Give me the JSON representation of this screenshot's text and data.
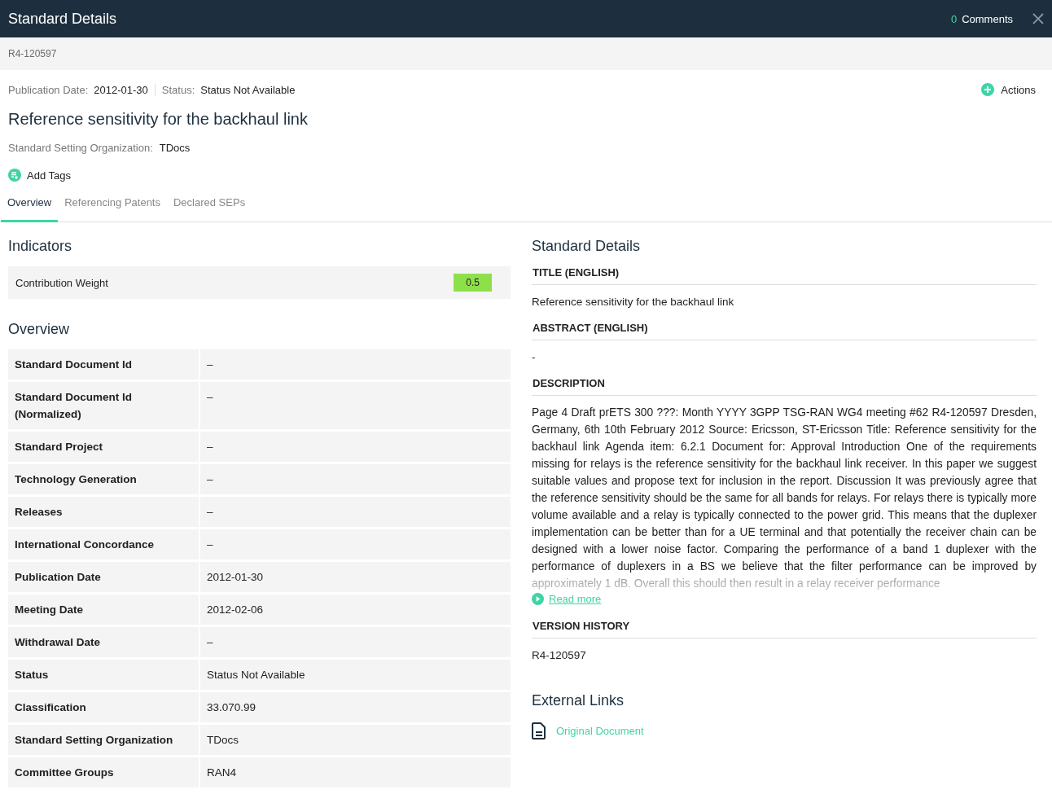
{
  "header": {
    "title": "Standard Details",
    "comment_count": "0",
    "comments_label": "Comments"
  },
  "document_id": "R4-120597",
  "meta": [
    {
      "label": "Publication Date:",
      "value": "2012-01-30"
    },
    {
      "label": "Status:",
      "value": "Status Not Available"
    }
  ],
  "actions_label": "Actions",
  "title": "Reference sensitivity for the backhaul link",
  "organization": {
    "label": "Standard Setting Organization:",
    "value": "TDocs"
  },
  "add_tags_label": "Add Tags",
  "tabs": [
    {
      "label": "Overview",
      "selected": true
    },
    {
      "label": "Referencing Patents",
      "selected": false
    },
    {
      "label": "Declared SEPs",
      "selected": false
    }
  ],
  "indicators": {
    "heading": "Indicators",
    "items": [
      {
        "label": "Contribution Weight",
        "value": "0.5"
      }
    ]
  },
  "overview": {
    "heading": "Overview",
    "rows": [
      {
        "label": "Standard Document Id",
        "value": "–"
      },
      {
        "label": "Standard Document Id (Normalized)",
        "value": "–"
      },
      {
        "label": "Standard Project",
        "value": "–"
      },
      {
        "label": "Technology Generation",
        "value": "–"
      },
      {
        "label": "Releases",
        "value": "–"
      },
      {
        "label": "International Concordance",
        "value": "–"
      },
      {
        "label": "Publication Date",
        "value": "2012-01-30"
      },
      {
        "label": "Meeting Date",
        "value": "2012-02-06"
      },
      {
        "label": "Withdrawal Date",
        "value": "–"
      },
      {
        "label": "Status",
        "value": "Status Not Available"
      },
      {
        "label": "Classification",
        "value": "33.070.99"
      },
      {
        "label": "Standard Setting Organization",
        "value": "TDocs"
      },
      {
        "label": "Committee Groups",
        "value": "RAN4"
      }
    ]
  },
  "details": {
    "heading": "Standard Details",
    "sections": [
      {
        "heading": "TITLE (ENGLISH)",
        "text": "Reference sensitivity for the backhaul link"
      },
      {
        "heading": "ABSTRACT (ENGLISH)",
        "text": "-"
      },
      {
        "heading": "DESCRIPTION",
        "text": "Page 4 Draft prETS 300 ???: Month YYYY 3GPP TSG-RAN WG4 meeting #62 R4-120597 Dresden, Germany, 6th 10th February 2012 Source: Ericsson, ST-Ericsson Title: Reference sensitivity for the backhaul link Agenda item: 6.2.1 Document for: Approval Introduction One of the requirements missing for relays is the reference sensitivity for the backhaul link receiver. In this paper we suggest suitable values and propose text for inclusion in the report. Discussion It was previously agree that the reference sensitivity should be the same for all bands for relays. For relays there is typically more volume available and a relay is typically connected to the power grid. This means that the duplexer implementation can be better than for a UE terminal and that potentially the receiver chain can be designed with a lower noise factor. Comparing the performance of a band 1 duplexer with the performance of duplexers in a BS we believe that the filter performance can be improved by approximately 1 dB. Overall this should then result in a relay receiver performance",
        "read_more": "Read more"
      },
      {
        "heading": "VERSION HISTORY",
        "text": "R4-120597"
      }
    ]
  },
  "external_links": {
    "heading": "External Links",
    "links": [
      "Original Document"
    ]
  }
}
